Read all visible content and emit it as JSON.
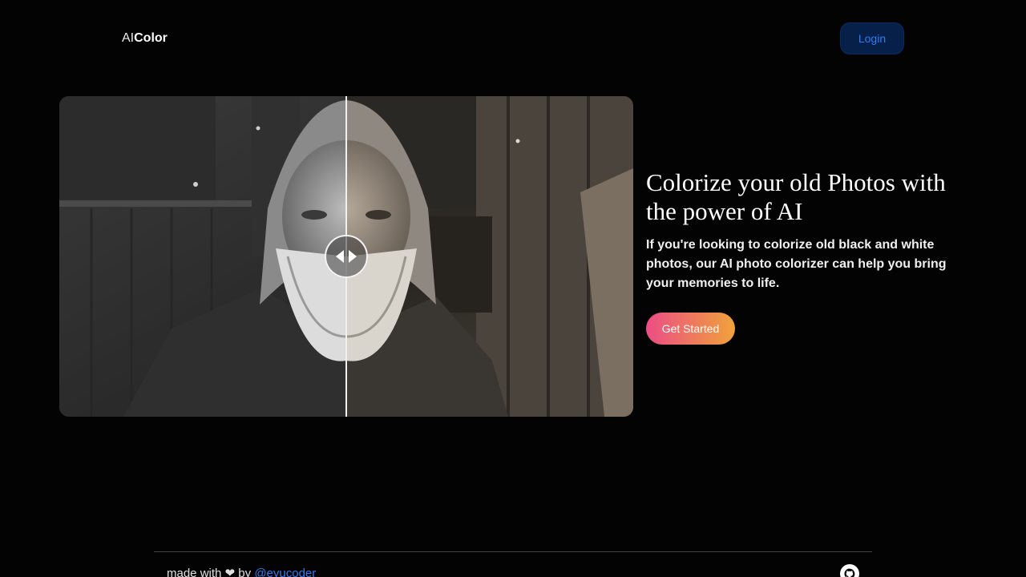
{
  "header": {
    "logo_prefix": "AI",
    "logo_bold": "Color",
    "login_label": "Login"
  },
  "comparison": {
    "image_description_icon": "image-compare-slider",
    "slider_position_percent": 50,
    "handle_icon": "left-right-arrows-icon"
  },
  "hero": {
    "title": "Colorize your old Photos with the power of AI",
    "subtitle": "If you're looking to colorize old black and white photos, our AI photo colorizer can help you bring your memories to life.",
    "cta_label": "Get Started"
  },
  "footer": {
    "made_with": "made with",
    "heart": "❤",
    "by": "by",
    "author_link": "@eyucoder",
    "github_icon": "github-icon"
  },
  "colors": {
    "background": "#030303",
    "accent_blue": "#2f7bf0",
    "cta_gradient_start": "#ec4d86",
    "cta_gradient_end": "#f0a23a"
  }
}
